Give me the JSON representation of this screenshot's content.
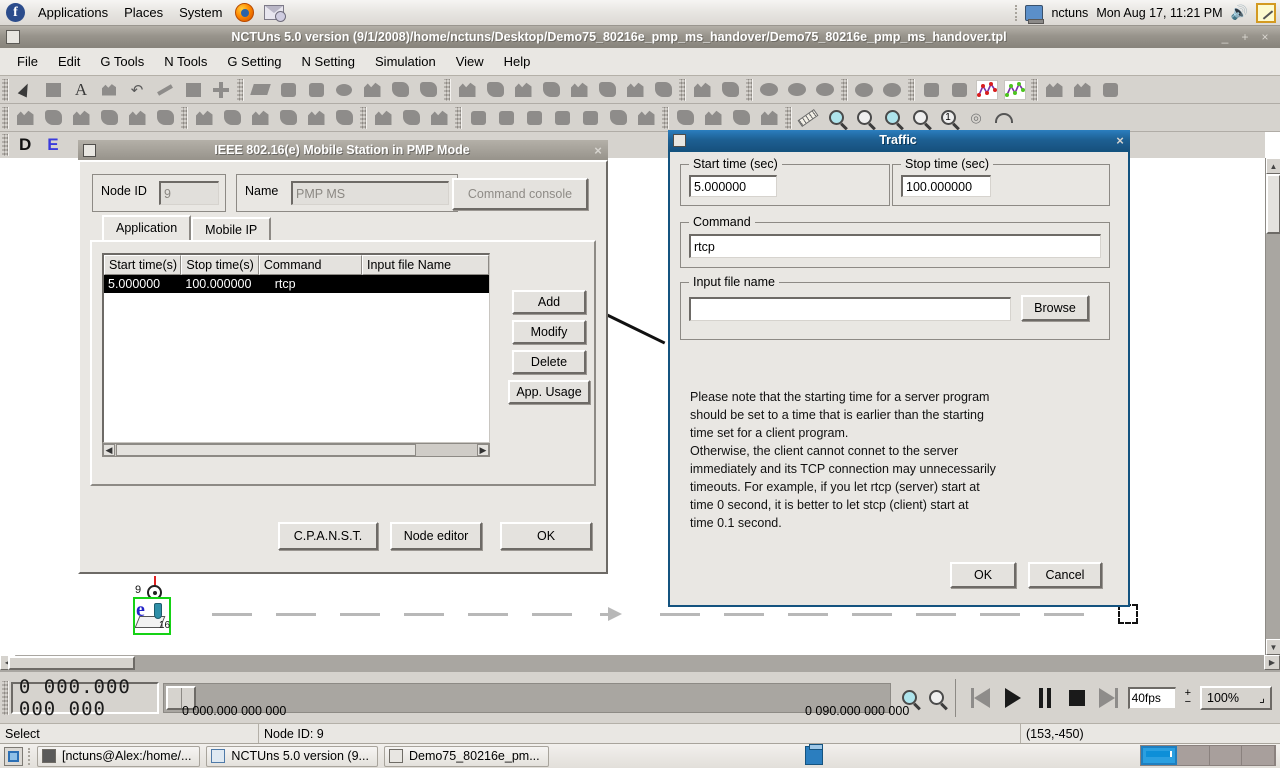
{
  "gnome_panel": {
    "logo": "fedora-logo",
    "menus": [
      "Applications",
      "Places",
      "System"
    ],
    "launchers": [
      "firefox-icon",
      "mail-icon"
    ],
    "user": "nctuns",
    "clock": "Mon Aug 17, 11:21 PM",
    "volume_icon": "volume-icon",
    "tray_icon": "notepad-icon"
  },
  "app_window": {
    "title": "NCTUns 5.0 version (9/1/2008)/home/nctuns/Desktop/Demo75_80216e_pmp_ms_handover/Demo75_80216e_pmp_ms_handover.tpl",
    "window_buttons": [
      "_",
      "+",
      "×"
    ],
    "menubar": [
      "File",
      "Edit",
      "G Tools",
      "N Tools",
      "G Setting",
      "N Setting",
      "Simulation",
      "View",
      "Help"
    ],
    "mode_letters": [
      "D",
      "E"
    ]
  },
  "toolbar": {
    "row1": [
      "select-arrow-icon",
      "rectangle-icon",
      "text-icon",
      "move-icon",
      "undo-icon",
      "link-icon",
      "node-box-icon",
      "crosshair-icon",
      "parallelogram-icon",
      "square-node-icon",
      "router-icon",
      "ellipse-node-icon",
      "host-icon",
      "switch-icon",
      "hub-icon",
      "subnet-icon",
      "gateway-icon",
      "wireless-node-icon",
      "mobile-node-icon",
      "ap-icon",
      "antenna-icon",
      "sensor-icon",
      "obstacle-icon",
      "satellite-icon",
      "base-station-icon",
      "cloud-icon",
      "cloud2-icon",
      "cloud3-icon",
      "ellipse-gray-icon",
      "ellipse-gray2-icon",
      "box-gray-icon",
      "box-gray2-icon",
      "plot-red-icon",
      "plot-green-icon",
      "shape-a-icon",
      "shape-b-icon",
      "shape-c-icon"
    ],
    "row2": [
      "ruler-icon",
      "zoom-in-icon",
      "zoom-out-icon",
      "zoom-fit-icon",
      "zoom-reset-icon",
      "zoom-one-icon",
      "signal-icon",
      "gauge-icon"
    ]
  },
  "ms_dialog": {
    "title": "IEEE 802.16(e) Mobile Station in PMP Mode",
    "close": "×",
    "node_id_label": "Node ID",
    "node_id_value": "9",
    "name_label": "Name",
    "name_value": "PMP MS",
    "command_console_label": "Command console",
    "tabs": [
      {
        "label": "Application",
        "active": true
      },
      {
        "label": "Mobile IP",
        "active": false
      }
    ],
    "table": {
      "columns": [
        "Start time(s)",
        "Stop time(s)",
        "Command",
        "Input file Name"
      ],
      "rows": [
        {
          "start": "5.000000",
          "stop": "100.000000",
          "command": "rtcp",
          "input_file": ""
        }
      ]
    },
    "side_buttons": [
      "Add",
      "Modify",
      "Delete",
      "App. Usage"
    ],
    "bottom_buttons": [
      "C.P.A.N.S.T.",
      "Node editor",
      "OK"
    ]
  },
  "traffic_dialog": {
    "title": "Traffic",
    "close": "×",
    "start_time_label": "Start time (sec)",
    "start_time_value": "5.000000",
    "stop_time_label": "Stop time (sec)",
    "stop_time_value": "100.000000",
    "command_label": "Command",
    "command_value": "rtcp",
    "input_file_label": "Input file name",
    "input_file_value": "",
    "browse_label": "Browse",
    "note": "Please note that the starting time for a server program should be set to a time that is earlier than the starting time set for a client program.\nOtherwise, the client cannot connet to the server immediately and its TCP connection may unnecessarily timeouts. For example, if you let rtcp (server) start at time 0 second, it is better to let stcp (client) start at time 0.1 second.",
    "note_lines": [
      "Please note that the starting time for a server program",
      "should be set to a time that is earlier than the starting",
      "time set for a client program.",
      "Otherwise, the client cannot connet to the server",
      "immediately and its TCP connection may unnecessarily",
      "timeouts. For example, if you let rtcp (server) start at",
      "time 0 second, it is better to let stcp (client) start at",
      "time 0.1 second."
    ],
    "ok_label": "OK",
    "cancel_label": "Cancel"
  },
  "canvas": {
    "node": {
      "id_label": "9",
      "sub_label": "16",
      "selected": true
    },
    "movement_path": "dashed-path-with-arrow"
  },
  "sim_bar": {
    "lcd_value": "0 000.000 000 000",
    "time_start": "0 000.000 000 000",
    "time_end": "0 090.000 000 000",
    "zoom_in_icon": "zoom-in-icon",
    "zoom_out_icon": "zoom-out-icon",
    "controls": [
      "rewind-button",
      "play-button",
      "pause-button",
      "stop-button",
      "forward-button"
    ],
    "fps_value": "40fps",
    "plus_label": "+",
    "minus_label": "−",
    "zoom_value": "100%"
  },
  "status_bar": {
    "mode": "Select",
    "node_info": "Node ID: 9",
    "coordinates": "(153,-450)"
  },
  "taskbar": {
    "show_desktop": "show-desktop-icon",
    "tasks": [
      {
        "icon": "terminal-icon",
        "label": "[nctuns@Alex:/home/..."
      },
      {
        "icon": "window-icon",
        "label": "NCTUns 5.0 version (9..."
      },
      {
        "icon": "document-icon",
        "label": "Demo75_80216e_pm..."
      }
    ],
    "tray_icon": "clipboard-icon",
    "workspaces": 4,
    "active_workspace": 1
  },
  "colors": {
    "title_active": "#1d5f92",
    "title_inactive": "#97938b",
    "face": "#e9e7e3",
    "canvas": "#ffffff",
    "selection": "#15d215",
    "row_selected": "#000000"
  }
}
